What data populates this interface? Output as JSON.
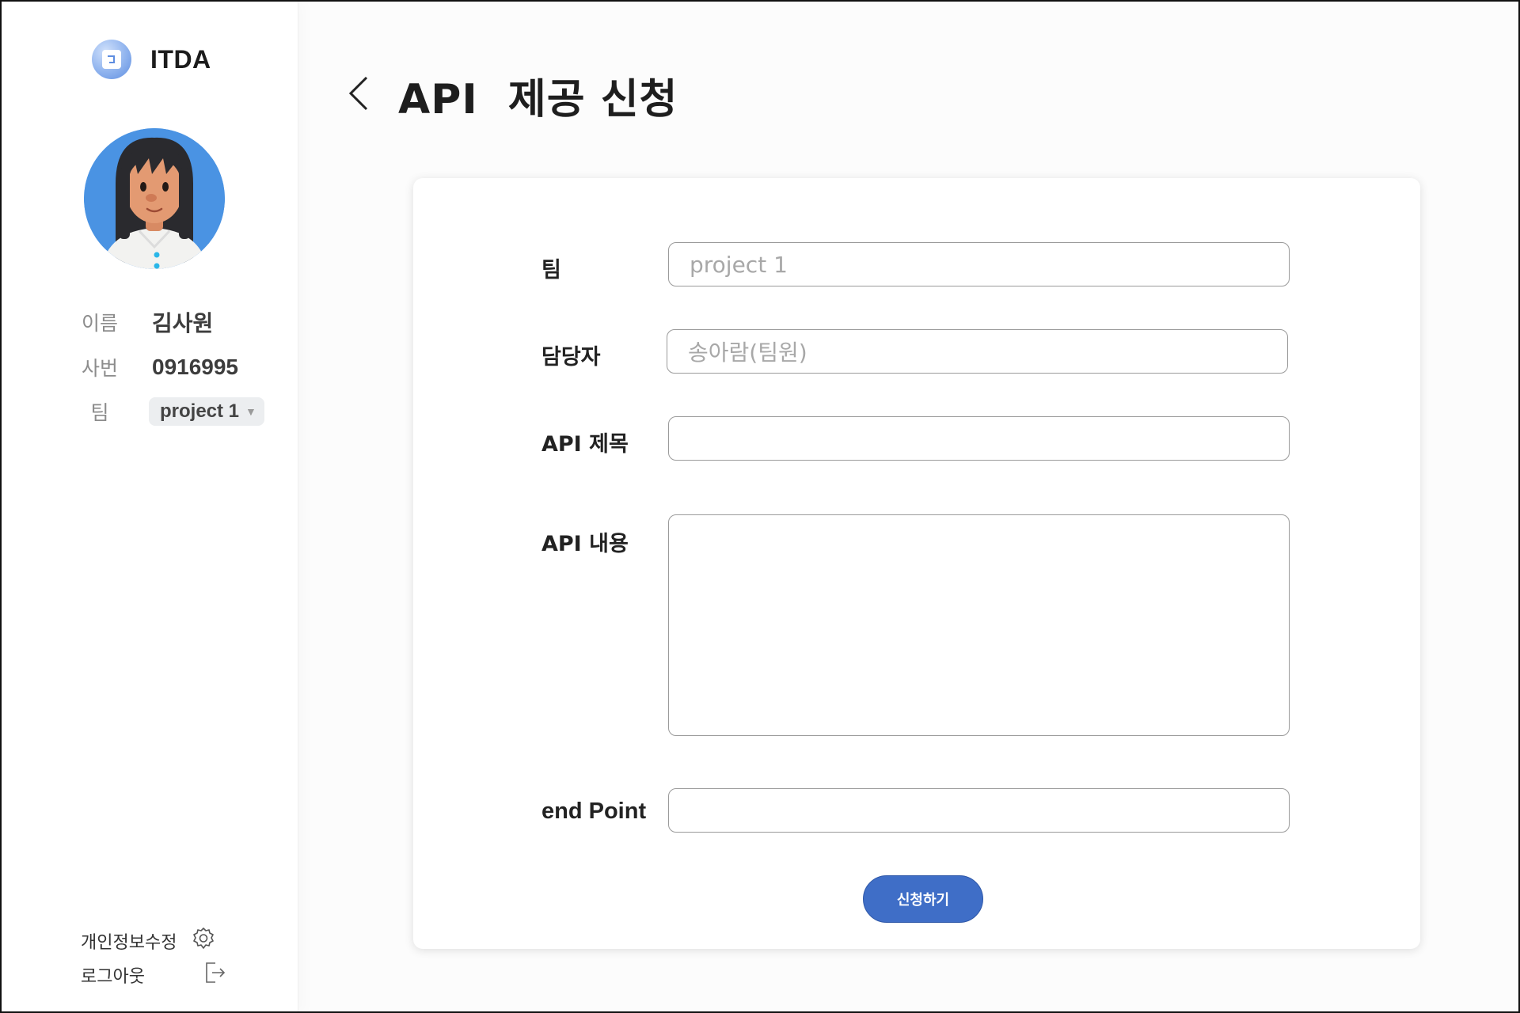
{
  "sidebar": {
    "brand": "ITDA",
    "profile": {
      "name_label": "이름",
      "name_value": "김사원",
      "emp_label": "사번",
      "emp_value": "0916995",
      "team_label": "팀",
      "team_value": "project 1"
    },
    "links": {
      "edit_profile": "개인정보수정",
      "logout": "로그아웃"
    }
  },
  "page": {
    "title": "API  제공 신청"
  },
  "form": {
    "team_label": "팀",
    "team_placeholder": "project 1",
    "manager_label": "담당자",
    "manager_placeholder": "송아람(팀원)",
    "api_title_label": "API 제목",
    "api_title_value": "",
    "api_content_label": "API 내용",
    "api_content_value": "",
    "endpoint_label": "end Point",
    "endpoint_value": "",
    "submit_label": "신청하기"
  },
  "colors": {
    "accent": "#3f6ec7",
    "avatar_bg": "#4a93e3"
  },
  "icons": {
    "logo": "itda-logo-icon",
    "back": "chevron-left-icon",
    "settings": "gear-icon",
    "logout": "logout-icon",
    "caret": "caret-down-icon"
  }
}
